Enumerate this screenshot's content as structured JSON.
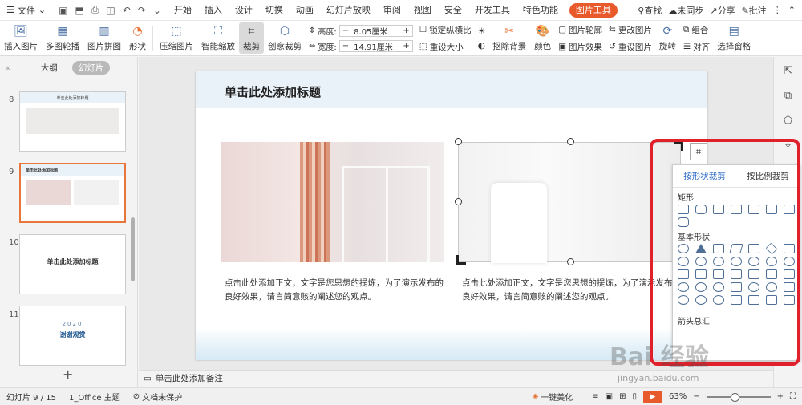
{
  "menubar": {
    "file_label": "文件",
    "tabs": [
      "开始",
      "插入",
      "设计",
      "切换",
      "动画",
      "幻灯片放映",
      "审阅",
      "视图",
      "安全",
      "开发工具",
      "特色功能"
    ],
    "active_tab": "图片工具",
    "search_label": "查找",
    "sync_label": "未同步",
    "share_label": "分享",
    "comment_label": "批注"
  },
  "ribbon": {
    "insert_picture": "插入图片",
    "multi_contour": "多图轮播",
    "picture_collage": "图片拼图",
    "shape": "形状",
    "compress": "压缩图片",
    "smart_scale": "智能缩放",
    "crop": "裁剪",
    "creative_crop": "创意裁剪",
    "height_label": "高度:",
    "height_value": "8.05厘米",
    "width_label": "宽度:",
    "width_value": "14.91厘米",
    "lock_ratio": "锁定纵横比",
    "reset_size": "重设大小",
    "remove_bg": "抠除背景",
    "color": "颜色",
    "picture_outline": "图片轮廓",
    "picture_effect": "图片效果",
    "change_picture": "更改图片",
    "reset_picture": "重设图片",
    "rotate": "旋转",
    "group": "组合",
    "align": "对齐",
    "select_pane": "选择窗格"
  },
  "leftpanel": {
    "tab_outline": "大纲",
    "tab_slides": "幻灯片",
    "thumbs": [
      {
        "num": "8",
        "title": "单击此处添加标题"
      },
      {
        "num": "9",
        "title": "单击此处添加标题"
      },
      {
        "num": "10",
        "title": "单击此处添加标题"
      },
      {
        "num": "11",
        "title": "2020",
        "sub": "谢谢观赏"
      }
    ],
    "add_label": "+"
  },
  "slide": {
    "title": "单击此处添加标题",
    "text_left": "点击此处添加正文，文字是您思想的提炼，为了演示发布的良好效果，请言简意赅的阐述您的观点。",
    "text_right": "点击此处添加正文，文字是您思想的提炼，为了演示发布的良好效果，请言简意赅的阐述您的观点。"
  },
  "popup": {
    "tab_shape": "按形状裁剪",
    "tab_ratio": "按比例裁剪",
    "section_rect": "矩形",
    "section_basic": "基本形状",
    "section_arrow": "箭头总汇"
  },
  "notes": {
    "placeholder": "单击此处添加备注"
  },
  "status": {
    "slide_info": "幻灯片 9 / 15",
    "theme": "1_Office 主题",
    "protect": "文档未保护",
    "beautify": "一键美化",
    "zoom": "63%"
  },
  "watermark": {
    "main": "Bai 经验",
    "sub": "jingyan.baidu.com"
  }
}
